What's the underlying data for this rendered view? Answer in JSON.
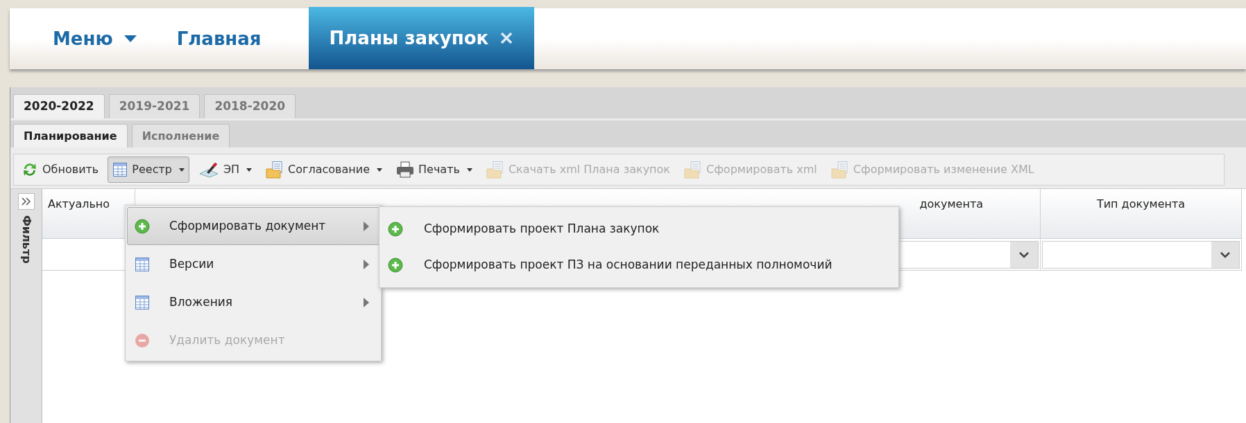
{
  "nav": [
    {
      "label": "Меню",
      "kind": "menu",
      "selected": false
    },
    {
      "label": "Главная",
      "kind": "link",
      "selected": false
    },
    {
      "label": "Планы закупок",
      "kind": "closable",
      "selected": true
    }
  ],
  "year_tabs": [
    {
      "label": "2020-2022",
      "selected": true
    },
    {
      "label": "2019-2021",
      "selected": false
    },
    {
      "label": "2018-2020",
      "selected": false
    }
  ],
  "sub_tabs": [
    {
      "label": "Планирование",
      "selected": true
    },
    {
      "label": "Исполнение",
      "selected": false
    }
  ],
  "toolbar": [
    {
      "label": "Обновить",
      "kind": "refresh",
      "dropdown": false,
      "disabled": false,
      "pressed": false
    },
    {
      "label": "Реестр",
      "kind": "table",
      "dropdown": true,
      "disabled": false,
      "pressed": true
    },
    {
      "label": "ЭП",
      "kind": "sign",
      "dropdown": true,
      "disabled": false,
      "pressed": false
    },
    {
      "label": "Согласование",
      "kind": "docs",
      "dropdown": true,
      "disabled": false,
      "pressed": false
    },
    {
      "label": "Печать",
      "kind": "print",
      "dropdown": true,
      "disabled": false,
      "pressed": false
    },
    {
      "label": "Скачать xml Плана закупок",
      "kind": "docs",
      "dropdown": false,
      "disabled": true,
      "pressed": false
    },
    {
      "label": "Сформировать xml",
      "kind": "docs",
      "dropdown": false,
      "disabled": true,
      "pressed": false
    },
    {
      "label": "Сформировать изменение XML",
      "kind": "docs",
      "dropdown": false,
      "disabled": true,
      "pressed": false
    }
  ],
  "filter_panel": {
    "label": "Фильтр"
  },
  "grid": {
    "columns": [
      {
        "label": "Актуально",
        "kind": "plain"
      },
      {
        "label": "документа",
        "kind": "combo"
      },
      {
        "label": "Тип документа",
        "kind": "combo"
      }
    ]
  },
  "menu": {
    "items": [
      {
        "label": "Сформировать документ",
        "kind": "add",
        "submenu": true,
        "disabled": false,
        "selected": true
      },
      {
        "label": "Версии",
        "kind": "table",
        "submenu": true,
        "disabled": false,
        "selected": false
      },
      {
        "label": "Вложения",
        "kind": "table",
        "submenu": true,
        "disabled": false,
        "selected": false
      },
      {
        "label": "Удалить документ",
        "kind": "remove",
        "submenu": false,
        "disabled": true,
        "selected": false
      }
    ],
    "submenu": [
      {
        "label": "Сформировать проект Плана закупок",
        "kind": "add"
      },
      {
        "label": "Сформировать проект ПЗ на основании переданных полномочий",
        "kind": "add"
      }
    ]
  }
}
